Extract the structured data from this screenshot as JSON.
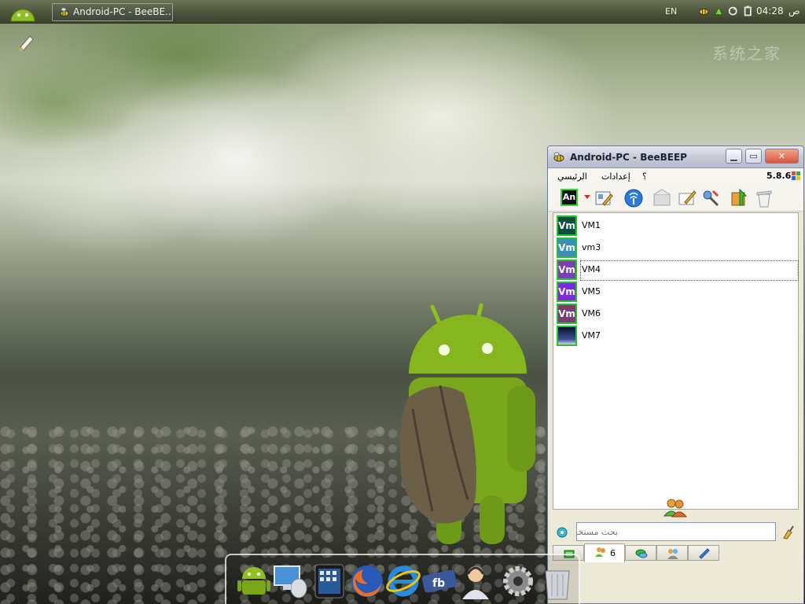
{
  "taskbar": {
    "window_button_label": "Android-PC - BeeBE...",
    "language": "EN",
    "clock_time": "04:28",
    "clock_ampm": "ص",
    "tray_icons": [
      "beebeep-tray-icon",
      "network-icon",
      "refresh-icon",
      "battery-icon"
    ]
  },
  "desktop": {
    "watermark": "系统之家"
  },
  "window": {
    "title": "Android-PC - BeeBEEP",
    "version": "5.8.6",
    "menu": {
      "main": "الرئيسي",
      "settings": "إعدادات",
      "help": "؟"
    },
    "status_avatar_label": "An",
    "toolbar_icons": [
      "edit-profile-icon",
      "network-icon",
      "mail-icon",
      "compose-icon",
      "tools-icon",
      "update-icon",
      "trash-icon"
    ],
    "users": [
      {
        "name": "VM1",
        "avatar": "Vm",
        "color": "#0b4f3c",
        "selected": false
      },
      {
        "name": "vm3",
        "avatar": "Vm",
        "color": "#3a8fb7",
        "selected": false
      },
      {
        "name": "VM4",
        "avatar": "Vm",
        "color": "#7a3fb5",
        "selected": true
      },
      {
        "name": "VM5",
        "avatar": "Vm",
        "color": "#7a2ae0",
        "selected": false
      },
      {
        "name": "VM6",
        "avatar": "Vm",
        "color": "#7b3b72",
        "selected": false
      },
      {
        "name": "VM7",
        "avatar": "",
        "color": "#1a2a55",
        "selected": false
      }
    ],
    "search_placeholder": "بحث مستخدم",
    "tabs": [
      {
        "id": "home",
        "icon": "home-icon",
        "count": ""
      },
      {
        "id": "users",
        "icon": "users-icon",
        "count": "6"
      },
      {
        "id": "chats",
        "icon": "chat-icon",
        "count": ""
      },
      {
        "id": "groups",
        "icon": "group-icon",
        "count": ""
      },
      {
        "id": "files",
        "icon": "share-icon",
        "count": ""
      }
    ]
  },
  "dock": {
    "items": [
      "android-icon",
      "computer-icon",
      "tablet-icon",
      "firefox-icon",
      "internet-explorer-icon",
      "facebook-icon",
      "support-icon",
      "settings-icon",
      "trash-icon"
    ]
  },
  "colors": {
    "online": "#27c22a",
    "title_text": "#1d2233",
    "close_button": "#d7563a"
  }
}
